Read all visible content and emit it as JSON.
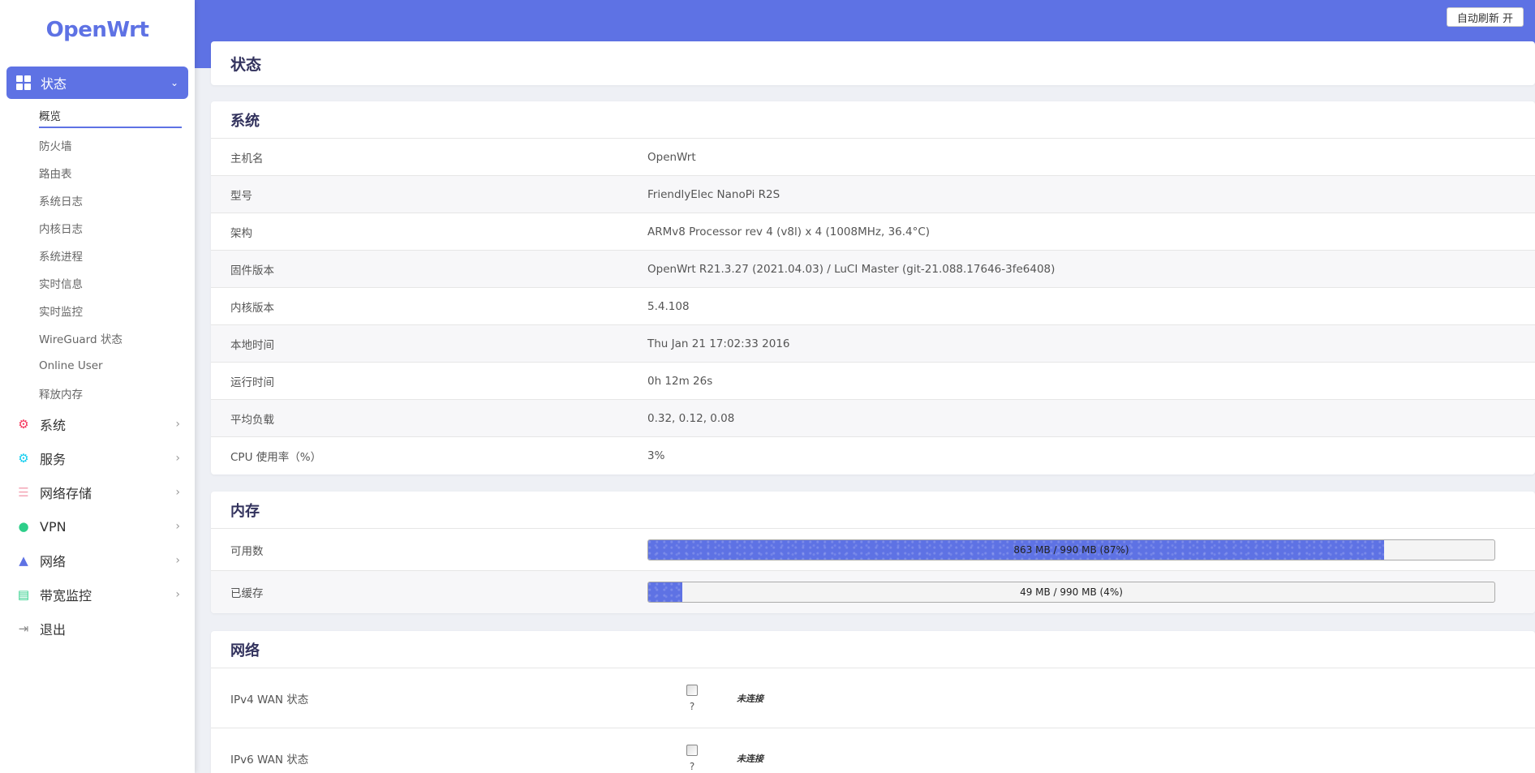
{
  "brand": "OpenWrt",
  "sidebar": {
    "active": {
      "label": "状态"
    },
    "submenu": [
      "概览",
      "防火墙",
      "路由表",
      "系统日志",
      "内核日志",
      "系统进程",
      "实时信息",
      "实时监控",
      "WireGuard 状态",
      "Online User",
      "释放内存"
    ],
    "items": [
      {
        "label": "系统",
        "icon": "gear-icon",
        "color": "#f5365c"
      },
      {
        "label": "服务",
        "icon": "services-icon",
        "color": "#11cdef"
      },
      {
        "label": "网络存储",
        "icon": "storage-icon",
        "color": "#f3a4b5"
      },
      {
        "label": "VPN",
        "icon": "vpn-icon",
        "color": "#2dce89"
      },
      {
        "label": "网络",
        "icon": "network-icon",
        "color": "#5e72e4"
      },
      {
        "label": "带宽监控",
        "icon": "monitor-icon",
        "color": "#2dce89"
      },
      {
        "label": "退出",
        "icon": "logout-icon",
        "color": "#888888"
      }
    ]
  },
  "header": {
    "refresh_label": "自动刷新 开"
  },
  "page_title": "状态",
  "system": {
    "title": "系统",
    "rows": [
      {
        "k": "主机名",
        "v": "OpenWrt"
      },
      {
        "k": "型号",
        "v": "FriendlyElec NanoPi R2S"
      },
      {
        "k": "架构",
        "v": "ARMv8 Processor rev 4 (v8l) x 4 (1008MHz, 36.4°C)"
      },
      {
        "k": "固件版本",
        "v": "OpenWrt R21.3.27 (2021.04.03) / LuCI Master (git-21.088.17646-3fe6408)"
      },
      {
        "k": "内核版本",
        "v": "5.4.108"
      },
      {
        "k": "本地时间",
        "v": "Thu Jan 21 17:02:33 2016"
      },
      {
        "k": "运行时间",
        "v": "0h 12m 26s"
      },
      {
        "k": "平均负载",
        "v": "0.32, 0.12, 0.08"
      },
      {
        "k": "CPU 使用率（%）",
        "v": "3%"
      }
    ]
  },
  "memory": {
    "title": "内存",
    "rows": [
      {
        "k": "可用数",
        "text": "863 MB / 990 MB (87%)",
        "fraction": 0.87
      },
      {
        "k": "已缓存",
        "text": "49 MB / 990 MB (4%)",
        "fraction": 0.04
      }
    ]
  },
  "network": {
    "title": "网络",
    "rows": [
      {
        "k": "IPv4 WAN 状态",
        "iface": "?",
        "status": "未连接"
      },
      {
        "k": "IPv6 WAN 状态",
        "iface": "?",
        "status": "未连接"
      }
    ]
  },
  "colors": {
    "accent": "#5e72e4"
  }
}
